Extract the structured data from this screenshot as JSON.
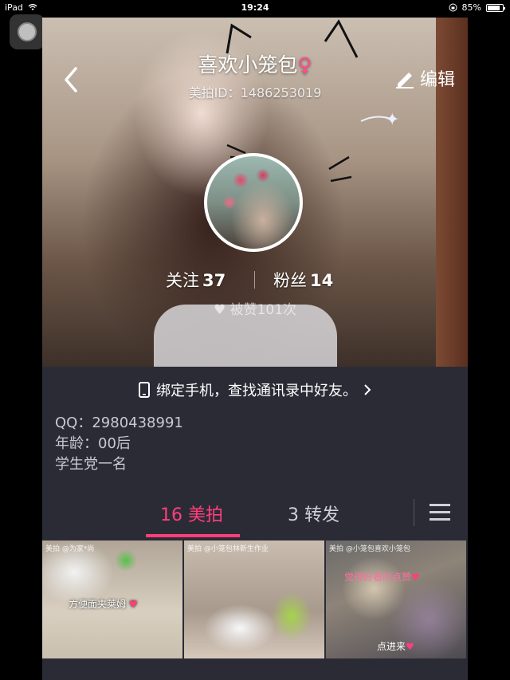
{
  "status_bar": {
    "device": "iPad",
    "time": "19:24",
    "battery": "85%",
    "battery_level": 0.85
  },
  "header": {
    "nickname": "喜欢小笼包",
    "gender_symbol": "♀",
    "meipai_id": "美拍ID：1486253019",
    "edit_label": "编辑"
  },
  "profile": {
    "follow_label": "关注",
    "follow_count": "37",
    "fans_label": "粉丝",
    "fans_count": "14",
    "likes_text": "被赞101次"
  },
  "bind_phone": {
    "text": "绑定手机，查找通讯录中好友。"
  },
  "info": {
    "qq": "QQ：2980438991",
    "age": "年龄：00后",
    "bio": "学生党一名"
  },
  "tabs": [
    {
      "label": "16 美拍",
      "active": true
    },
    {
      "label": "3 转发",
      "active": false
    }
  ],
  "thumbnails": [
    {
      "tag": "美拍 @为家*尚",
      "caption": "方便面夹莱姆"
    },
    {
      "tag": "美拍 @小笼包林新生作业",
      "caption": ""
    },
    {
      "tag": "美拍 @小笼包喜欢小笼包",
      "caption": "觉得好看的点赞",
      "caption2": "点进来"
    }
  ],
  "colors": {
    "accent": "#ff3f7a",
    "panel_bg": "#2b2b36",
    "gender": "#ff4d8d"
  },
  "icons": [
    "back-chevron-icon",
    "pencil-icon",
    "phone-icon",
    "chevron-right-icon",
    "heart-icon",
    "menu-icon",
    "wifi-icon",
    "lock-rotation-icon",
    "battery-icon"
  ]
}
